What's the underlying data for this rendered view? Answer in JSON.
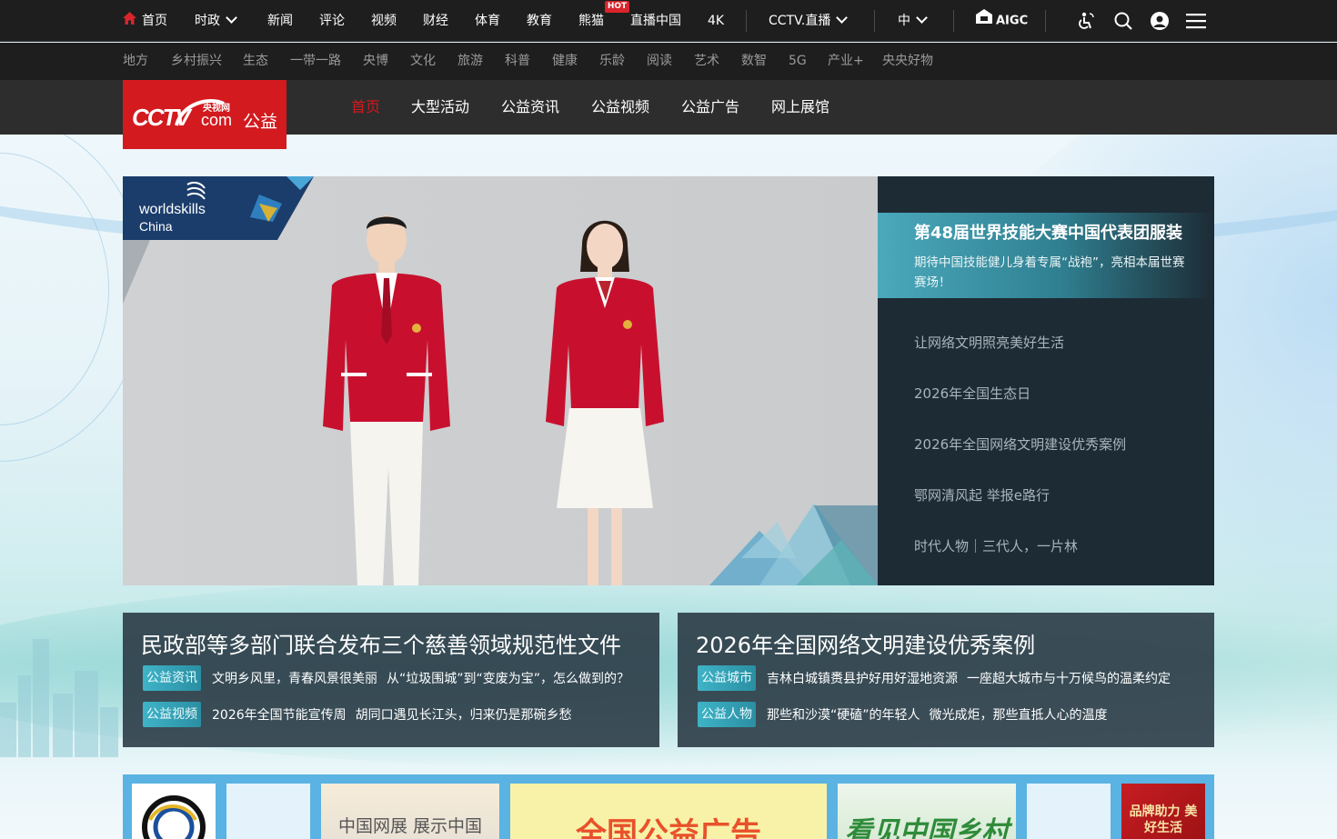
{
  "topnav": {
    "home": "首页",
    "shizheng": "时政",
    "items": [
      "新闻",
      "评论",
      "视频",
      "财经",
      "体育",
      "教育",
      "熊猫",
      "直播中国",
      "4K"
    ],
    "hot_badge": "HOT",
    "cctv_live": "CCTV.直播",
    "lang": "中",
    "aigc": "AIGC"
  },
  "subnav": [
    "地方",
    "乡村振兴",
    "生态",
    "一带一路",
    "央博",
    "文化",
    "旅游",
    "科普",
    "健康",
    "乐龄",
    "阅读",
    "艺术",
    "数智",
    "5G",
    "产业+",
    "央央好物"
  ],
  "logo": {
    "cctv": "CCTV",
    "com": "com",
    "cn": "央视网",
    "gongyi": "公益"
  },
  "mainnav": [
    {
      "label": "首页",
      "active": true
    },
    {
      "label": "大型活动"
    },
    {
      "label": "公益资讯"
    },
    {
      "label": "公益视频"
    },
    {
      "label": "公益广告"
    },
    {
      "label": "网上展馆"
    }
  ],
  "hero": {
    "brand_line1": "worldskills",
    "brand_line2": "China"
  },
  "featured": {
    "title": "第48届世界技能大赛中国代表团服装",
    "desc": "期待中国技能健儿身着专属“战袍”，亮相本届世赛赛场！"
  },
  "side_links": [
    "让网络文明照亮美好生活",
    "2026年全国生态日",
    "2026年全国网络文明建设优秀案例",
    "鄂网清风起 举报e路行",
    "时代人物｜三代人，一片林"
  ],
  "cards": [
    {
      "title": "民政部等多部门联合发布三个慈善领域规范性文件",
      "rows": [
        {
          "tag": "公益资讯",
          "items": [
            "文明乡风里，青春风景很美丽",
            "从“垃圾围城”到“变废为宝”，怎么做到的？"
          ]
        },
        {
          "tag": "公益视频",
          "items": [
            "2026年全国节能宣传周",
            "胡同口遇见长江头，归来仍是那碗乡愁"
          ]
        }
      ]
    },
    {
      "title": "2026年全国网络文明建设优秀案例",
      "rows": [
        {
          "tag": "公益城市",
          "items": [
            "吉林白城镇赉县护好用好湿地资源",
            "一座超大城市与十万候鸟的温柔约定"
          ]
        },
        {
          "tag": "公益人物",
          "items": [
            "那些和沙漠“硬磕”的年轻人",
            "微光成炬，那些直抵人心的温度"
          ]
        }
      ]
    }
  ],
  "tiles": {
    "t2": "中国网展 展示中国",
    "t3": "全国公益广告",
    "t4": "看见中国乡村",
    "t6": "品牌助力 美好生活"
  },
  "colors": {
    "brand_red": "#d21a1f",
    "dark_bar": "#1e1e1e",
    "nav_bar": "#2d2d2d",
    "side_panel": "#1d2b35",
    "teal": "#3fb3c7"
  }
}
